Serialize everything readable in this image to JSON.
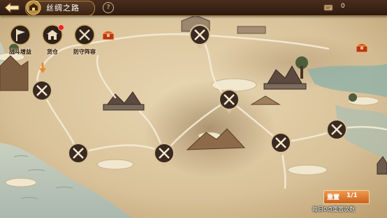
{
  "header": {
    "title": "丝绸之路",
    "help_symbol": "?",
    "resource_count": "0"
  },
  "menu": [
    {
      "label": "战斗增益",
      "icon": "battle-flag-icon"
    },
    {
      "label": "货仓",
      "icon": "warehouse-icon",
      "notification": true
    },
    {
      "label": "防守阵容",
      "icon": "crossed-swords-icon"
    }
  ],
  "map": {
    "stage_nodes": [
      {
        "id": "stage-1",
        "icon": "crossed-swords-icon"
      },
      {
        "id": "stage-2",
        "icon": "crossed-swords-icon"
      },
      {
        "id": "stage-3",
        "icon": "crossed-swords-icon"
      },
      {
        "id": "stage-4",
        "icon": "crossed-swords-icon"
      },
      {
        "id": "stage-5",
        "icon": "crossed-swords-icon"
      },
      {
        "id": "stage-6",
        "icon": "crossed-swords-icon"
      },
      {
        "id": "stage-7",
        "icon": "crossed-swords-icon"
      }
    ],
    "current_marker_icon": "arrow-down-marker-icon",
    "chests": [
      "treasure-chest-icon",
      "treasure-chest-icon"
    ]
  },
  "progress": {
    "label": "重置",
    "value": "1/1",
    "note": "每日0点重置次数"
  },
  "colors": {
    "parchment": "#d9c29a",
    "sea": "#b9c7bd",
    "accent_orange": "#e07a2e",
    "node_dark": "#3a2a20"
  }
}
